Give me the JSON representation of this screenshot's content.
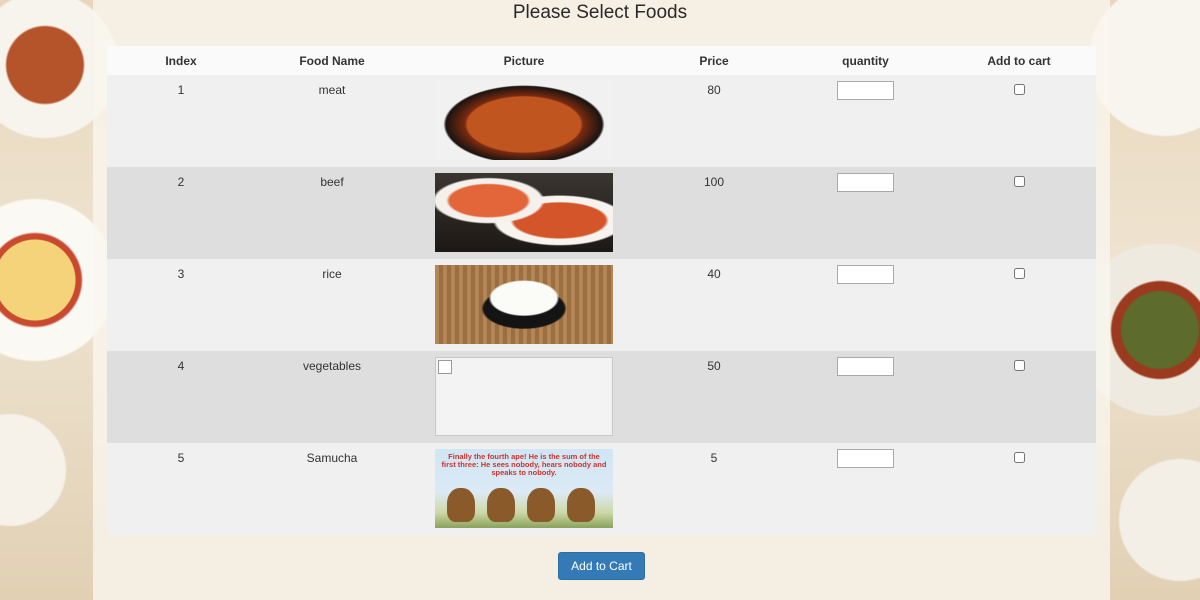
{
  "page": {
    "title": "Please Select Foods",
    "accent_color": "#337ab7"
  },
  "table": {
    "headers": {
      "index": "Index",
      "food_name": "Food Name",
      "picture": "Picture",
      "price": "Price",
      "quantity": "quantity",
      "add_to_cart": "Add to cart"
    },
    "rows": [
      {
        "index": "1",
        "name": "meat",
        "price": "80",
        "quantity": "",
        "checked": false,
        "picture_icon": "meat-curry-image"
      },
      {
        "index": "2",
        "name": "beef",
        "price": "100",
        "quantity": "",
        "checked": false,
        "picture_icon": "beef-dish-image"
      },
      {
        "index": "3",
        "name": "rice",
        "price": "40",
        "quantity": "",
        "checked": false,
        "picture_icon": "rice-bowl-image"
      },
      {
        "index": "4",
        "name": "vegetables",
        "price": "50",
        "quantity": "",
        "checked": false,
        "picture_icon": "broken-image-icon"
      },
      {
        "index": "5",
        "name": "Samucha",
        "price": "5",
        "quantity": "",
        "checked": false,
        "picture_icon": "three-monkeys-image",
        "picture_text": "Finally the fourth ape! He is the sum of the first three: He sees nobody, hears nobody and speaks to nobody."
      }
    ]
  },
  "actions": {
    "add_to_cart_label": "Add to Cart"
  }
}
